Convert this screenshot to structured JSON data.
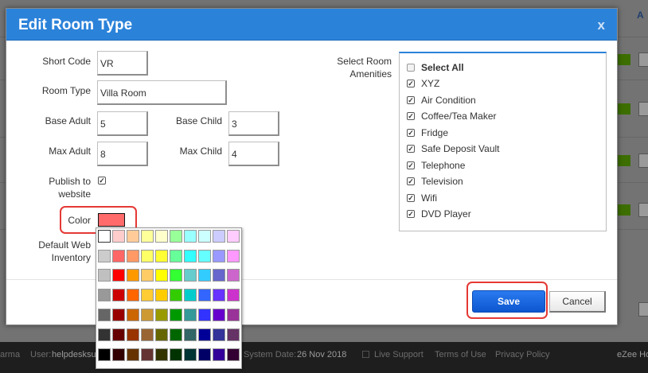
{
  "modal": {
    "title": "Edit Room Type",
    "close_label": "x"
  },
  "form": {
    "short_code_label": "Short Code",
    "short_code_value": "VR",
    "room_type_label": "Room Type",
    "room_type_value": "Villa Room",
    "base_adult_label": "Base Adult",
    "base_adult_value": "5",
    "base_child_label": "Base Child",
    "base_child_value": "3",
    "max_adult_label": "Max Adult",
    "max_adult_value": "8",
    "max_child_label": "Max Child",
    "max_child_value": "4",
    "publish_label_line1": "Publish to",
    "publish_label_line2": "website",
    "publish_checked": true,
    "color_label": "Color",
    "color_value": "#ff6b6b",
    "default_web_line1": "Default Web",
    "default_web_line2": "Inventory"
  },
  "amenities": {
    "label_line1": "Select Room",
    "label_line2": "Amenities",
    "select_all_label": "Select All",
    "select_all_checked": false,
    "items": [
      {
        "label": "XYZ",
        "checked": true
      },
      {
        "label": "Air Condition",
        "checked": true
      },
      {
        "label": "Coffee/Tea Maker",
        "checked": true
      },
      {
        "label": "Fridge",
        "checked": true
      },
      {
        "label": "Safe Deposit Vault",
        "checked": true
      },
      {
        "label": "Telephone",
        "checked": true
      },
      {
        "label": "Television",
        "checked": true
      },
      {
        "label": "Wifi",
        "checked": true
      },
      {
        "label": "DVD Player",
        "checked": true
      }
    ]
  },
  "buttons": {
    "save_label": "Save",
    "cancel_label": "Cancel"
  },
  "color_picker": {
    "rows": [
      [
        "#ffffff",
        "#ffcccc",
        "#ffcc99",
        "#ffff99",
        "#ffffcc",
        "#99ff99",
        "#99ffff",
        "#ccffff",
        "#ccccff",
        "#ffccff"
      ],
      [
        "#cccccc",
        "#ff6666",
        "#ff9966",
        "#ffff66",
        "#ffff33",
        "#66ff99",
        "#33ffff",
        "#66ffff",
        "#9999ff",
        "#ff99ff"
      ],
      [
        "#c0c0c0",
        "#ff0000",
        "#ff9900",
        "#ffcc66",
        "#ffff00",
        "#33ff33",
        "#66cccc",
        "#33ccff",
        "#6666cc",
        "#cc66cc"
      ],
      [
        "#999999",
        "#cc0000",
        "#ff6600",
        "#ffcc33",
        "#ffcc00",
        "#33cc00",
        "#00cccc",
        "#3366ff",
        "#6633ff",
        "#cc33cc"
      ],
      [
        "#666666",
        "#990000",
        "#cc6600",
        "#cc9933",
        "#999900",
        "#009900",
        "#339999",
        "#3333ff",
        "#6600cc",
        "#993399"
      ],
      [
        "#333333",
        "#660000",
        "#993300",
        "#996633",
        "#666600",
        "#006600",
        "#336666",
        "#000099",
        "#333399",
        "#663366"
      ],
      [
        "#000000",
        "#330000",
        "#663300",
        "#663333",
        "#333300",
        "#003300",
        "#003333",
        "#000066",
        "#330099",
        "#330033"
      ]
    ]
  },
  "background": {
    "corner_letter": "A",
    "footer": {
      "app_fragment": "arma",
      "user_label": "User:",
      "user_value": "helpdesksu",
      "system_date_label": "System Date:",
      "system_date_value": "26 Nov 2018",
      "live_support": "Live Support",
      "terms": "Terms of Use",
      "privacy": "Privacy Policy",
      "brand": "eZee Ho"
    }
  }
}
